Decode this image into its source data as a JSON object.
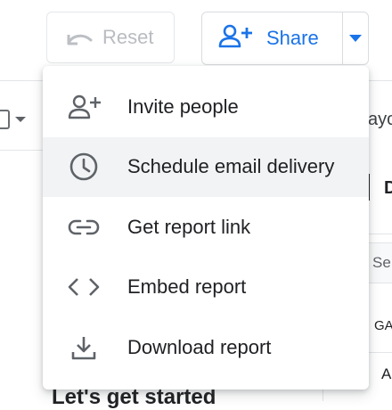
{
  "toolbar": {
    "reset_label": "Reset",
    "share_label": "Share"
  },
  "menu": {
    "items": [
      {
        "label": "Invite people",
        "icon": "person-add-icon"
      },
      {
        "label": "Schedule email delivery",
        "icon": "clock-icon",
        "active": true
      },
      {
        "label": "Get report link",
        "icon": "link-icon"
      },
      {
        "label": "Embed report",
        "icon": "code-icon"
      },
      {
        "label": "Download report",
        "icon": "download-icon"
      }
    ]
  },
  "canvas": {
    "heading_partial": "Let's get started"
  },
  "right_panel": {
    "text_1": "ayo",
    "text_d": "D",
    "search_partial": "Se",
    "text_ga": "GA",
    "text_a": "A"
  },
  "colors": {
    "accent": "#1a73e8",
    "disabled_text": "#b9bcc1",
    "menu_active_bg": "#f1f3f4",
    "icon_gray": "#5f6368"
  }
}
